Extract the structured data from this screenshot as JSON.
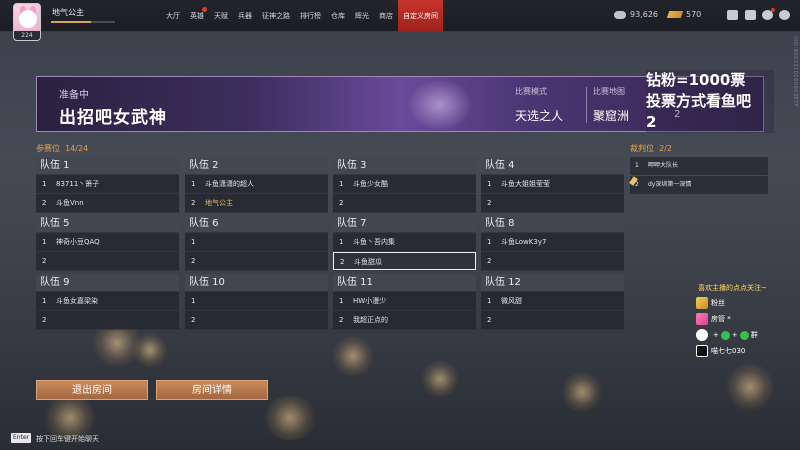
{
  "player": {
    "name": "地气公主",
    "level": "224",
    "xp_fraction": 0.62
  },
  "nav": {
    "items": [
      {
        "label": "大厅",
        "active": false,
        "dot": false
      },
      {
        "label": "英雄",
        "active": false,
        "dot": true
      },
      {
        "label": "天赋",
        "active": false,
        "dot": false
      },
      {
        "label": "兵器",
        "active": false,
        "dot": false
      },
      {
        "label": "征神之路",
        "active": false,
        "dot": false
      },
      {
        "label": "排行榜",
        "active": false,
        "dot": false
      },
      {
        "label": "仓库",
        "active": false,
        "dot": false
      },
      {
        "label": "辉光",
        "active": false,
        "dot": false
      },
      {
        "label": "商店",
        "active": false,
        "dot": false
      },
      {
        "label": "自定义房间",
        "active": true,
        "dot": false
      }
    ]
  },
  "currency": {
    "silver": "93,626",
    "gold": "570"
  },
  "top_icons": [
    "mail-icon",
    "id-card-icon",
    "friends-icon",
    "settings-icon"
  ],
  "side_text": "UID:8003310160003E7F",
  "room": {
    "status": "准备中",
    "name": "出招吧女武神",
    "mode_label": "比赛模式",
    "mode_value": "天选之人",
    "map_label": "比赛地图",
    "map_value": "聚窟洲",
    "extra_value": "2"
  },
  "overlay": {
    "line1": "钻粉=1000票",
    "line2": "投票方式看鱼吧",
    "line3": "2"
  },
  "participants_label": "参赛位",
  "participants_count": "14/24",
  "referee_label": "裁判位",
  "referee_count": "2/2",
  "teams": [
    {
      "name": "队伍 1",
      "slots": [
        {
          "num": "1",
          "player": "83711丶箫子"
        },
        {
          "num": "2",
          "player": "斗鱼Vnn"
        }
      ]
    },
    {
      "name": "队伍 2",
      "slots": [
        {
          "num": "1",
          "player": "斗鱼潇潇的超人"
        },
        {
          "num": "2",
          "player": "地气公主",
          "gold": true
        }
      ]
    },
    {
      "name": "队伍 3",
      "slots": [
        {
          "num": "1",
          "player": "斗鱼少女酷"
        },
        {
          "num": "2",
          "player": ""
        }
      ]
    },
    {
      "name": "队伍 4",
      "slots": [
        {
          "num": "1",
          "player": "斗鱼大姐姐莹莹"
        },
        {
          "num": "2",
          "player": ""
        }
      ]
    },
    {
      "name": "队伍 5",
      "slots": [
        {
          "num": "1",
          "player": "神奇小豆QAQ"
        },
        {
          "num": "2",
          "player": ""
        }
      ]
    },
    {
      "name": "队伍 6",
      "slots": [
        {
          "num": "1",
          "player": ""
        },
        {
          "num": "2",
          "player": ""
        }
      ]
    },
    {
      "name": "队伍 7",
      "slots": [
        {
          "num": "1",
          "player": "斗鱼丶吾内集"
        },
        {
          "num": "2",
          "player": "斗鱼甜瓜",
          "selected": true
        }
      ]
    },
    {
      "name": "队伍 8",
      "slots": [
        {
          "num": "1",
          "player": "斗鱼LowK3y7"
        },
        {
          "num": "2",
          "player": ""
        }
      ]
    },
    {
      "name": "队伍 9",
      "slots": [
        {
          "num": "1",
          "player": "斗鱼女嘉梁染"
        },
        {
          "num": "2",
          "player": ""
        }
      ]
    },
    {
      "name": "队伍 10",
      "slots": [
        {
          "num": "1",
          "player": ""
        },
        {
          "num": "2",
          "player": ""
        }
      ]
    },
    {
      "name": "队伍 11",
      "slots": [
        {
          "num": "1",
          "player": "HW小漫少"
        },
        {
          "num": "2",
          "player": "我超正点的"
        }
      ]
    },
    {
      "name": "队伍 12",
      "slots": [
        {
          "num": "1",
          "player": "微风甜"
        },
        {
          "num": "2",
          "player": ""
        }
      ]
    }
  ],
  "referees": [
    {
      "num": "1",
      "player": "呷呷大队长"
    },
    {
      "num": "2",
      "player": "dy深圳第一深情"
    }
  ],
  "buttons": {
    "exit": "退出房间",
    "details": "房间详情"
  },
  "chat": {
    "key": "Enter",
    "hint": "按下回车键开始聊天"
  },
  "stream": {
    "title": "喜欢主播的点点关注~",
    "fan": "粉丝",
    "admin": "房管 *",
    "groups": "群",
    "douyin": "喵七七030"
  }
}
